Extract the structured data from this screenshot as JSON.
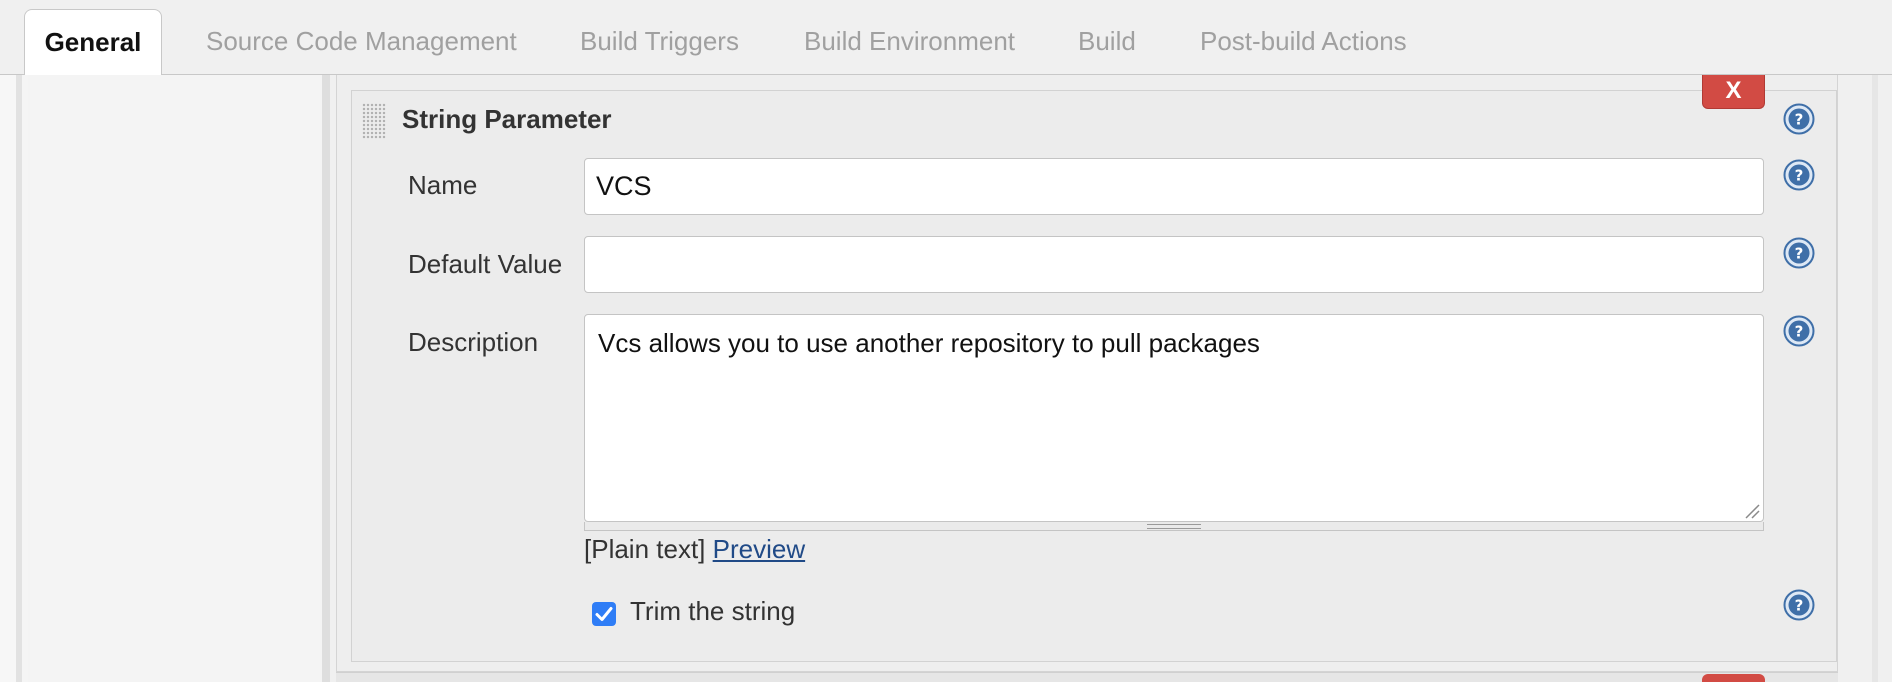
{
  "tabs": [
    {
      "label": "General",
      "active": true
    },
    {
      "label": "Source Code Management",
      "active": false
    },
    {
      "label": "Build Triggers",
      "active": false
    },
    {
      "label": "Build Environment",
      "active": false
    },
    {
      "label": "Build",
      "active": false
    },
    {
      "label": "Post-build Actions",
      "active": false
    }
  ],
  "parameter": {
    "title": "String Parameter",
    "delete_label": "X",
    "name_label": "Name",
    "name_value": "VCS",
    "default_label": "Default Value",
    "default_value": "",
    "description_label": "Description",
    "description_value": "Vcs allows you to use another repository to pull packages",
    "markup_prefix": "[Plain text]",
    "preview_label": "Preview",
    "trim_label": "Trim the string",
    "trim_checked": true
  },
  "icons": {
    "help": "help-icon",
    "checkbox": "checkmark-icon",
    "drag": "drag-handle-icon"
  },
  "colors": {
    "delete_button": "#d24b44",
    "help_icon": "#3f6fa8",
    "link": "#204a87",
    "checkbox": "#2f7df6"
  }
}
